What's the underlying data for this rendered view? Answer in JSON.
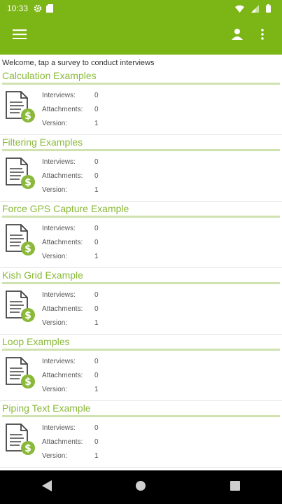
{
  "status_bar": {
    "time": "10:33"
  },
  "welcome_text": "Welcome, tap a survey to conduct interviews",
  "labels": {
    "interviews": "Interviews:",
    "attachments": "Attachments:",
    "version": "Version:"
  },
  "surveys": [
    {
      "title": "Calculation Examples",
      "interviews": "0",
      "attachments": "0",
      "version": "1"
    },
    {
      "title": "Filtering Examples",
      "interviews": "0",
      "attachments": "0",
      "version": "1"
    },
    {
      "title": "Force GPS Capture Example",
      "interviews": "0",
      "attachments": "0",
      "version": "1"
    },
    {
      "title": "Kish Grid Example",
      "interviews": "0",
      "attachments": "0",
      "version": "1"
    },
    {
      "title": "Loop Examples",
      "interviews": "0",
      "attachments": "0",
      "version": "1"
    },
    {
      "title": "Piping Text Example",
      "interviews": "0",
      "attachments": "0",
      "version": "1"
    }
  ],
  "colors": {
    "primary": "#7cb516",
    "title_text": "#8ab93a",
    "rule": "#cfe2b0",
    "nav_bar": "#000000"
  },
  "icons": {
    "status": [
      "gear-icon",
      "sd-card-icon",
      "wifi-icon",
      "signal-icon",
      "battery-icon"
    ],
    "app_bar": [
      "menu-icon",
      "user-icon",
      "more-vert-icon"
    ],
    "nav": [
      "back-icon",
      "home-icon",
      "recents-icon"
    ]
  }
}
